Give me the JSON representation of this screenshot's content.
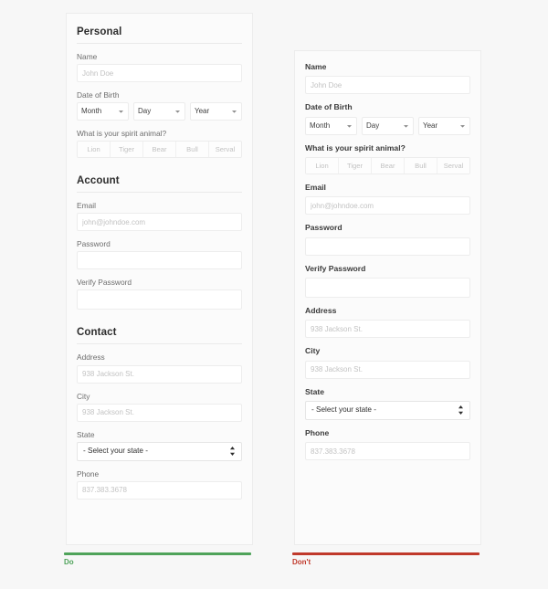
{
  "page": {
    "background": "#f7f7f7"
  },
  "colors": {
    "do_bar": "#4fa35a",
    "dont_bar": "#c0392b",
    "do_label": "#4fa35a",
    "dont_label": "#c0392b",
    "card_bg": "#fbfbfb",
    "input_bg": "#ffffff",
    "placeholder": "#c3c3c3"
  },
  "do_panel": {
    "sections": [
      {
        "heading": "Personal",
        "fields": [
          {
            "label": "Name",
            "type": "text",
            "value": "",
            "placeholder": "John Doe"
          },
          {
            "label": "Date of Birth",
            "type": "date-selects",
            "selects": [
              {
                "name": "month",
                "value": "Month"
              },
              {
                "name": "day",
                "value": "Day"
              },
              {
                "name": "year",
                "value": "Year"
              }
            ]
          },
          {
            "label": "What is your spirit animal?",
            "type": "segmented",
            "options": [
              "Lion",
              "Tiger",
              "Bear",
              "Bull",
              "Serval"
            ]
          }
        ]
      },
      {
        "heading": "Account",
        "fields": [
          {
            "label": "Email",
            "type": "text",
            "value": "",
            "placeholder": "john@johndoe.com"
          },
          {
            "label": "Password",
            "type": "password",
            "value": "",
            "placeholder": ""
          },
          {
            "label": "Verify Password",
            "type": "password",
            "value": "",
            "placeholder": ""
          }
        ]
      },
      {
        "heading": "Contact",
        "fields": [
          {
            "label": "Address",
            "type": "text",
            "value": "",
            "placeholder": "938 Jackson St."
          },
          {
            "label": "City",
            "type": "text",
            "value": "",
            "placeholder": "938 Jackson St."
          },
          {
            "label": "State",
            "type": "select",
            "value": "- Select your state -"
          },
          {
            "label": "Phone",
            "type": "text",
            "value": "",
            "placeholder": "837.383.3678"
          }
        ]
      }
    ],
    "verdict": {
      "label": "Do"
    }
  },
  "dont_panel": {
    "fields": [
      {
        "label": "Name",
        "type": "text",
        "value": "",
        "placeholder": "John Doe"
      },
      {
        "label": "Date of Birth",
        "type": "date-selects",
        "selects": [
          {
            "name": "month",
            "value": "Month"
          },
          {
            "name": "day",
            "value": "Day"
          },
          {
            "name": "year",
            "value": "Year"
          }
        ]
      },
      {
        "label": "What is your spirit animal?",
        "type": "segmented",
        "options": [
          "Lion",
          "Tiger",
          "Bear",
          "Bull",
          "Serval"
        ]
      },
      {
        "label": "Email",
        "type": "text",
        "value": "",
        "placeholder": "john@johndoe.com"
      },
      {
        "label": "Password",
        "type": "password",
        "value": "",
        "placeholder": ""
      },
      {
        "label": "Verify Password",
        "type": "password",
        "value": "",
        "placeholder": ""
      },
      {
        "label": "Address",
        "type": "text",
        "value": "",
        "placeholder": "938 Jackson St."
      },
      {
        "label": "City",
        "type": "text",
        "value": "",
        "placeholder": "938 Jackson St."
      },
      {
        "label": "State",
        "type": "select",
        "value": "- Select your state -"
      },
      {
        "label": "Phone",
        "type": "text",
        "value": "",
        "placeholder": "837.383.3678"
      }
    ],
    "verdict": {
      "label": "Don't"
    }
  },
  "icons": {
    "dropdown_caret": "chevron-down-icon",
    "select_stepper": "select-stepper-icon"
  }
}
